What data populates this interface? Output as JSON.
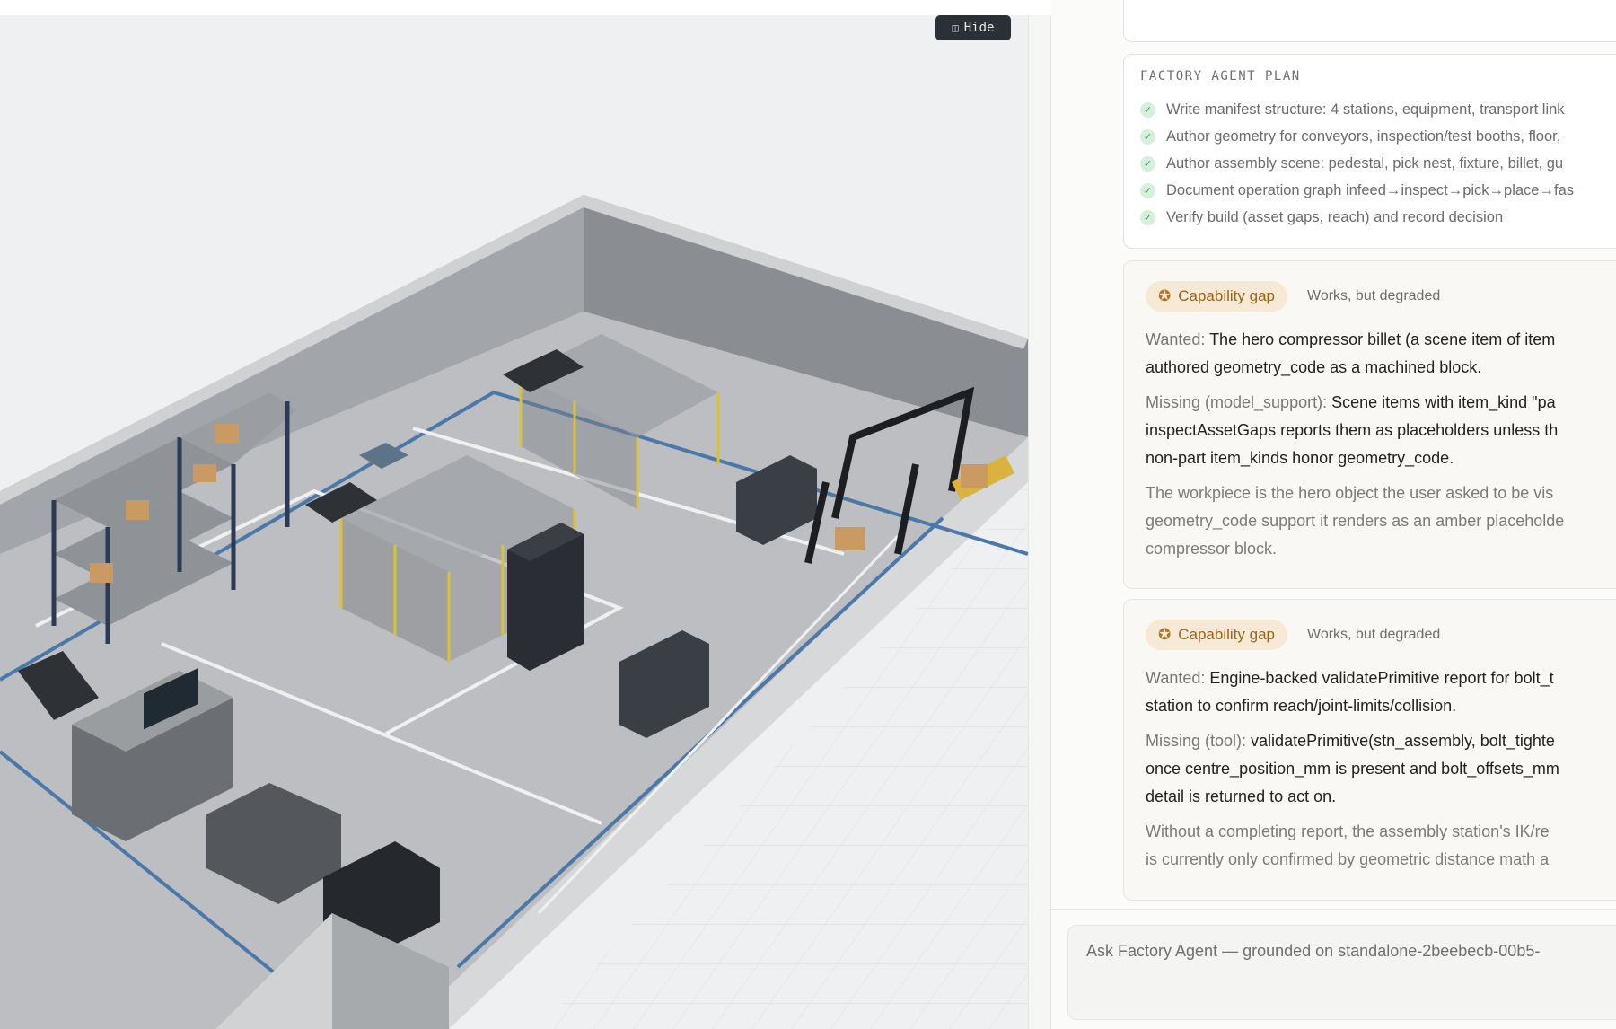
{
  "viewport": {
    "hide_label": "Hide",
    "hide_icon": "panel-collapse-icon"
  },
  "plan": {
    "title": "FACTORY AGENT PLAN",
    "items": [
      "Write manifest structure: 4 stations, equipment, transport link",
      "Author geometry for conveyors, inspection/test booths, floor,",
      "Author assembly scene: pedestal, pick nest, fixture, billet, gu",
      "Document operation graph infeed→inspect→pick→place→fas",
      "Verify build (asset gaps, reach) and record decision"
    ]
  },
  "gaps": [
    {
      "badge": "Capability gap",
      "status": "Works, but degraded",
      "wanted_label": "Wanted:",
      "wanted_lines": [
        "The hero compressor billet (a scene item of item",
        "authored geometry_code as a machined block."
      ],
      "missing_label": "Missing (model_support):",
      "missing_lines": [
        "Scene items with item_kind \"pa",
        "inspectAssetGaps reports them as placeholders unless th",
        "non-part item_kinds honor geometry_code."
      ],
      "note_lines": [
        "The workpiece is the hero object the user asked to be vis",
        "geometry_code support it renders as an amber placeholde",
        "compressor block."
      ]
    },
    {
      "badge": "Capability gap",
      "status": "Works, but degraded",
      "wanted_label": "Wanted:",
      "wanted_lines": [
        "Engine-backed validatePrimitive report for bolt_t",
        "station to confirm reach/joint-limits/collision."
      ],
      "missing_label": "Missing (tool):",
      "missing_lines": [
        "validatePrimitive(stn_assembly, bolt_tighte",
        "once centre_position_mm is present and bolt_offsets_mm",
        "detail is returned to act on."
      ],
      "note_lines": [
        "Without a completing report, the assembly station's IK/re",
        "is currently only confirmed by geometric distance math a"
      ]
    }
  ],
  "ask": {
    "placeholder": "Ask Factory Agent — grounded on standalone-2beebecb-00b5-"
  },
  "colors": {
    "accent_amber": "#9a6417",
    "badge_bg": "#f6ead6",
    "check_green": "#2e9a55",
    "floor": "#bcbec1",
    "lane_blue": "#4a78a8",
    "fence_yellow": "#d9c13a"
  }
}
